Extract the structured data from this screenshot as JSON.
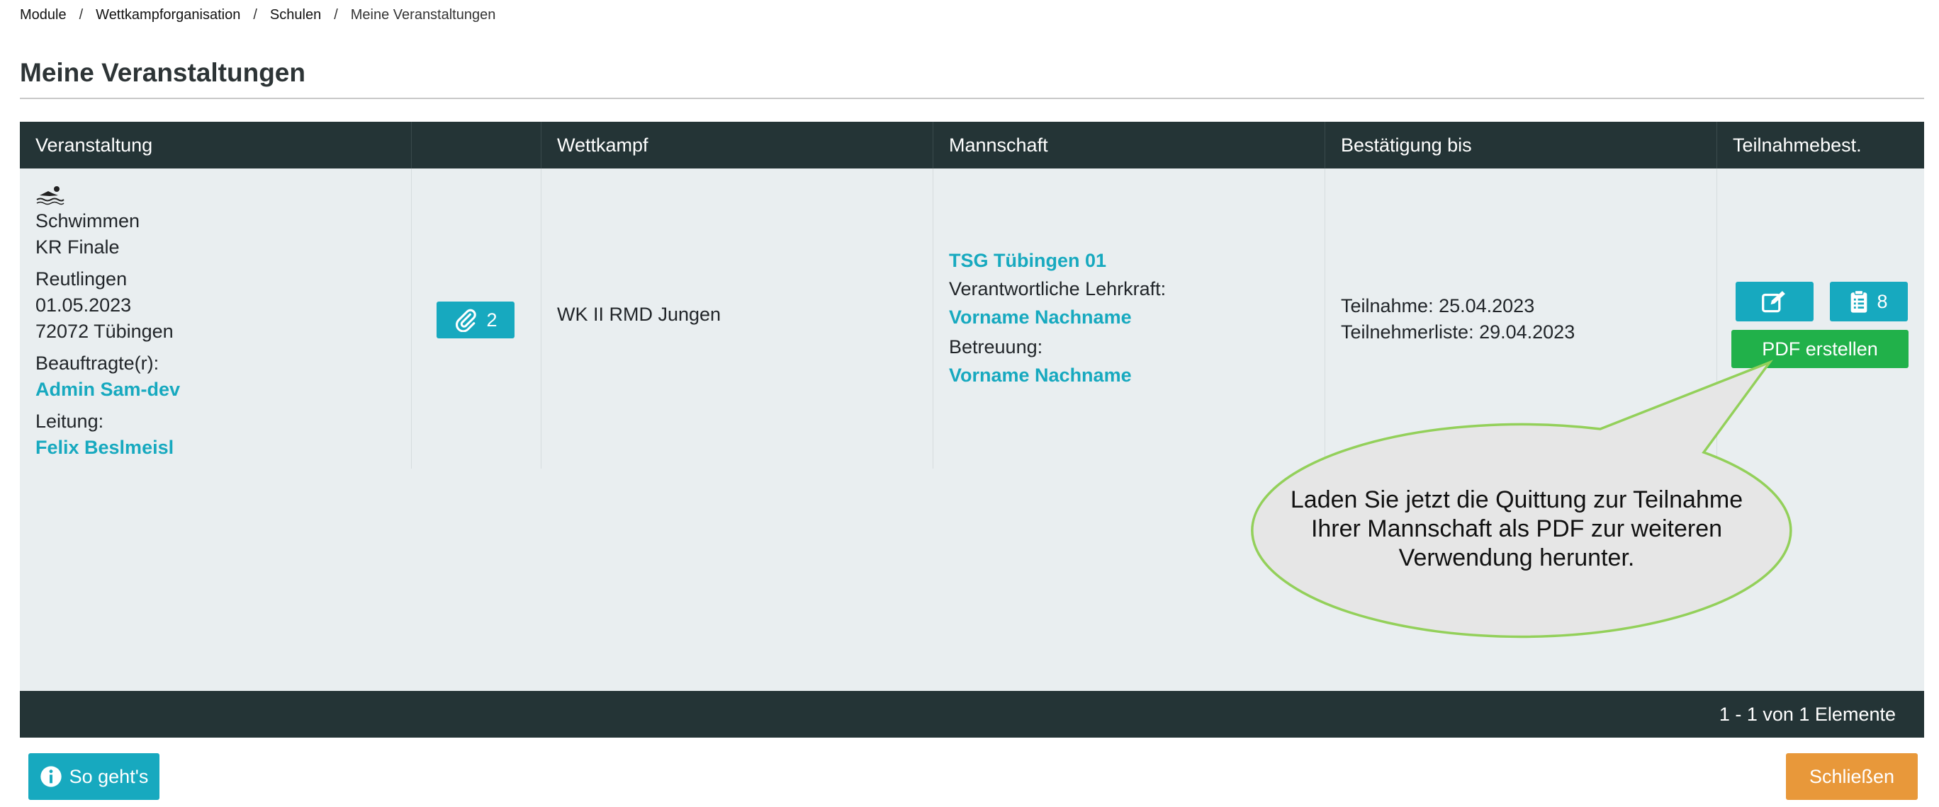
{
  "breadcrumb": {
    "items": [
      "Module",
      "Wettkampforganisation",
      "Schulen"
    ],
    "current": "Meine Veranstaltungen",
    "separator": "/"
  },
  "page": {
    "title": "Meine Veranstaltungen"
  },
  "table": {
    "columns": [
      "Veranstaltung",
      "",
      "Wettkampf",
      "Mannschaft",
      "Bestätigung bis",
      "Teilnahmebest."
    ],
    "row": {
      "sport_icon": "swimmer-icon",
      "sport": "Schwimmen",
      "event_name": "KR Finale",
      "location": "Reutlingen",
      "date": "01.05.2023",
      "address": "72072 Tübingen",
      "commissioner_label": "Beauftragte(r):",
      "commissioner": "Admin Sam-dev",
      "lead_label": "Leitung:",
      "lead": "Felix Beslmeisl",
      "attachments_count": "2",
      "competition": "WK II RMD Jungen",
      "team_name": "TSG Tübingen 01",
      "teacher_label": "Verantwortliche Lehrkraft:",
      "teacher": "Vorname Nachname",
      "support_label": "Betreuung:",
      "support": "Vorname Nachname",
      "confirm_participation": "Teilnahme: 25.04.2023",
      "confirm_list": "Teilnehmerliste: 29.04.2023",
      "participants_count": "8",
      "pdf_label": "PDF erstellen"
    },
    "pager_info": "1 - 1 von 1 Elemente"
  },
  "callout": {
    "text": "Laden Sie jetzt die Quittung zur Teilnahme Ihrer Mannschaft als PDF zur weiteren Verwendung herunter."
  },
  "footer": {
    "howto_label": "So geht's",
    "close_label": "Schließen"
  },
  "colors": {
    "header_bg": "#243436",
    "accent": "#17a9bf",
    "pdf_green": "#21b14a",
    "close_orange": "#e8983a",
    "row_bg": "#e9eef0"
  }
}
